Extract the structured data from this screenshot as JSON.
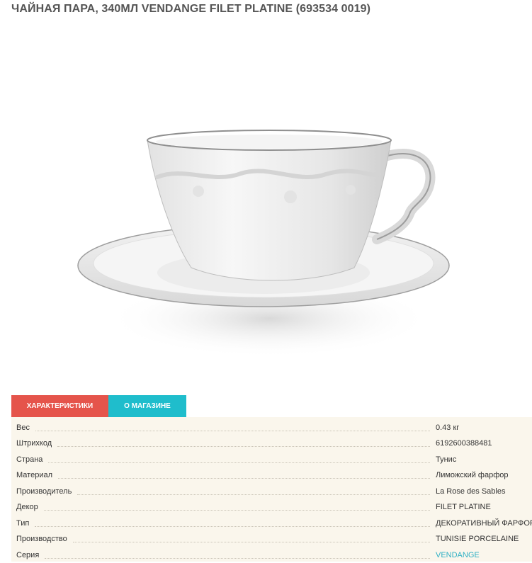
{
  "product": {
    "title": "ЧАЙНАЯ ПАРА, 340МЛ VENDANGE FILET PLATINE (693534 0019)"
  },
  "tabs": [
    {
      "label": "ХАРАКТЕРИСТИКИ",
      "color": "#e5544b"
    },
    {
      "label": "О МАГАЗИНЕ",
      "color": "#1fbdcc"
    }
  ],
  "specs": [
    {
      "label": "Вес",
      "value": "0.43 кг"
    },
    {
      "label": "Штрихкод",
      "value": "6192600388481"
    },
    {
      "label": "Страна",
      "value": "Тунис"
    },
    {
      "label": "Материал",
      "value": "Лиможский фарфор"
    },
    {
      "label": "Производитель",
      "value": "La Rose des Sables"
    },
    {
      "label": "Декор",
      "value": "FILET PLATINE"
    },
    {
      "label": "Тип",
      "value": "ДЕКОРАТИВНЫЙ ФАРФОР"
    },
    {
      "label": "Производство",
      "value": "TUNISIE PORCELAINE"
    },
    {
      "label": "Серия",
      "value": "VENDANGE"
    }
  ],
  "colors": {
    "link": "#2fb0c4",
    "specs_bg": "#faf6ec"
  }
}
